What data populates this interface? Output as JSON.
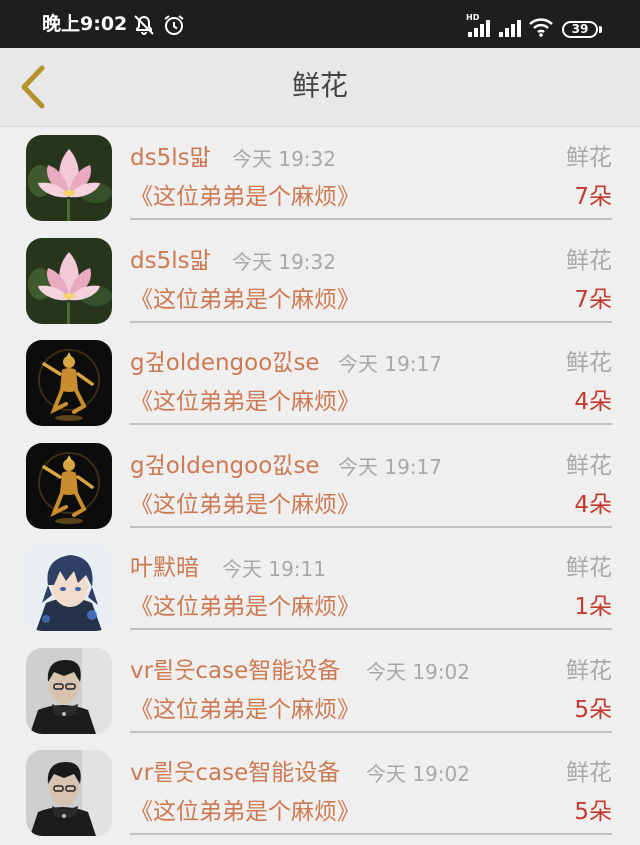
{
  "status_bar": {
    "time": "晚上9:02",
    "battery": "39",
    "network_label": "HD"
  },
  "header": {
    "title": "鲜花"
  },
  "items": [
    {
      "name": "ds5ls맓",
      "time": "今天 19:32",
      "gift": "鲜花",
      "book": "《这位弟弟是个麻烦》",
      "count": "7朵",
      "avatar": "lotus"
    },
    {
      "name": "ds5ls맓",
      "time": "今天 19:32",
      "gift": "鲜花",
      "book": "《这位弟弟是个麻烦》",
      "count": "7朵",
      "avatar": "lotus"
    },
    {
      "name": "g겊oldengoo낎se",
      "time": "今天 19:17",
      "gift": "鲜花",
      "book": "《这位弟弟是个麻烦》",
      "count": "4朵",
      "avatar": "deity"
    },
    {
      "name": "g겊oldengoo낎se",
      "time": "今天 19:17",
      "gift": "鲜花",
      "book": "《这位弟弟是个麻烦》",
      "count": "4朵",
      "avatar": "deity"
    },
    {
      "name": "叶默暗",
      "time": "今天 19:11",
      "gift": "鲜花",
      "book": "《这位弟弟是个麻烦》",
      "count": "1朵",
      "avatar": "anime"
    },
    {
      "name": "vr릩웃case智能设备",
      "time": "今天 19:02",
      "gift": "鲜花",
      "book": "《这位弟弟是个麻烦》",
      "count": "5朵",
      "avatar": "portrait"
    },
    {
      "name": "vr릩웃case智能设备",
      "time": "今天 19:02",
      "gift": "鲜花",
      "book": "《这位弟弟是个麻烦》",
      "count": "5朵",
      "avatar": "portrait"
    }
  ],
  "colors": {
    "name": "#cd7a52",
    "count": "#c23b2e",
    "muted": "#a8a8a8",
    "back_arrow": "#b5922a"
  }
}
